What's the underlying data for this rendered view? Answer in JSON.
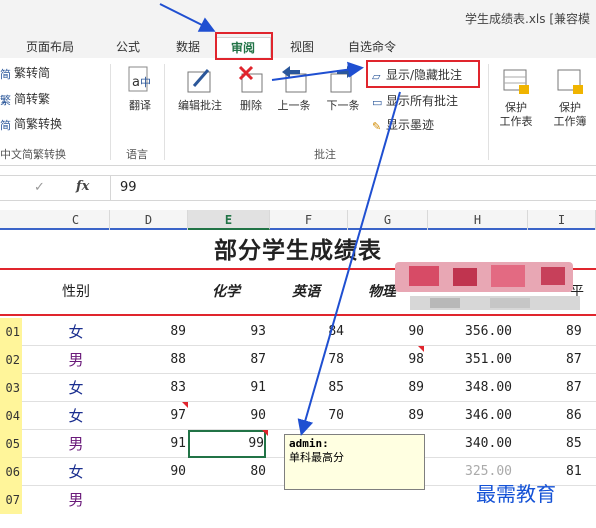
{
  "titlebar": {
    "title": "学生成绩表.xls  [兼容模"
  },
  "tabs": [
    {
      "label": "页面布局"
    },
    {
      "label": "公式"
    },
    {
      "label": "数据"
    },
    {
      "label": "审阅",
      "active": true
    },
    {
      "label": "视图"
    },
    {
      "label": "自选命令"
    }
  ],
  "ribbon": {
    "chinese_convert": {
      "to_simplified": "繁转简",
      "to_traditional": "简转繁",
      "convert": "简繁转换",
      "group": "中文简繁转换"
    },
    "language": {
      "translate": "翻译",
      "group": "语言"
    },
    "comments": {
      "edit": "编辑批注",
      "delete": "删除",
      "previous": "上一条",
      "next": "下一条",
      "show_hide": "显示/隐藏批注",
      "show_all": "显示所有批注",
      "show_ink": "显示墨迹",
      "group": "批注"
    },
    "protect": {
      "protect_sheet_1": "保护",
      "protect_sheet_2": "工作表",
      "protect_book_1": "保护",
      "protect_book_2": "工作簿"
    }
  },
  "formula_bar": {
    "fx": "fx",
    "value": "99"
  },
  "columns": [
    "C",
    "D",
    "E",
    "F",
    "G",
    "H",
    "I"
  ],
  "active_column": "E",
  "sheet": {
    "title": "部分学生成绩表",
    "headers": {
      "gender": "性别",
      "chemistry": "化学",
      "english": "英语",
      "physics": "物理",
      "last": "平"
    },
    "rows": [
      {
        "id": "01",
        "gender": "女",
        "d": "89",
        "chem": "93",
        "eng": "84",
        "phys": "90",
        "total": "356.00",
        "avg": "89"
      },
      {
        "id": "02",
        "gender": "男",
        "d": "88",
        "chem": "87",
        "eng": "78",
        "phys": "98",
        "total": "351.00",
        "avg": "87"
      },
      {
        "id": "03",
        "gender": "女",
        "d": "83",
        "chem": "91",
        "eng": "85",
        "phys": "89",
        "total": "348.00",
        "avg": "87"
      },
      {
        "id": "04",
        "gender": "女",
        "d": "97",
        "chem": "90",
        "eng": "70",
        "phys": "89",
        "total": "346.00",
        "avg": "86"
      },
      {
        "id": "05",
        "gender": "男",
        "d": "91",
        "chem": "99",
        "eng": "",
        "phys": "",
        "total": "340.00",
        "avg": "85"
      },
      {
        "id": "06",
        "gender": "女",
        "d": "90",
        "chem": "80",
        "eng": "",
        "phys": "",
        "total": "325.00",
        "avg": "81"
      },
      {
        "id": "07",
        "gender": "男",
        "d": "",
        "chem": "",
        "eng": "",
        "phys": "",
        "total": "",
        "avg": ""
      }
    ]
  },
  "comment": {
    "author": "admin:",
    "text": "单科最高分"
  },
  "watermark": "最需教育",
  "colors": {
    "accent_green": "#217346",
    "highlight_red": "#e0252d",
    "arrow_blue": "#1f4fd1",
    "row_header_yellow": "#fff59a"
  }
}
